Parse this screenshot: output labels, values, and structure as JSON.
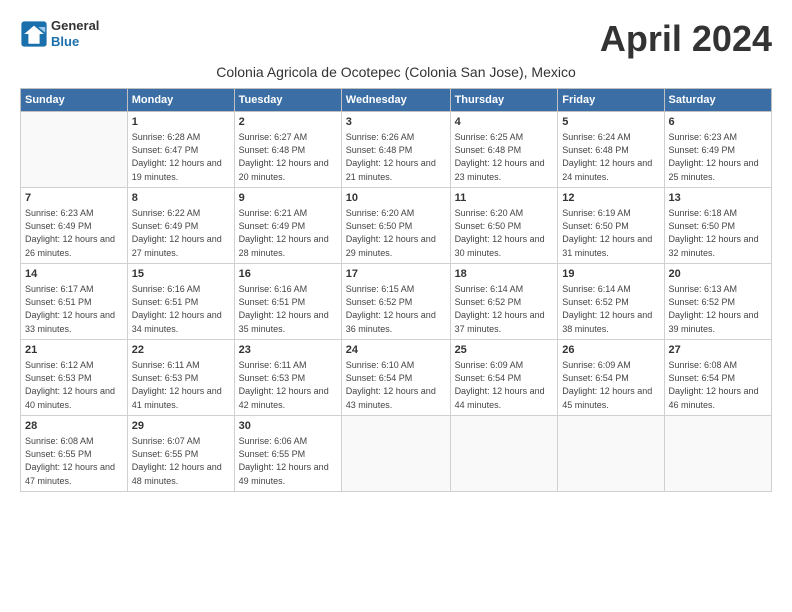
{
  "header": {
    "logo_line1": "General",
    "logo_line2": "Blue",
    "month": "April 2024",
    "subtitle": "Colonia Agricola de Ocotepec (Colonia San Jose), Mexico"
  },
  "weekdays": [
    "Sunday",
    "Monday",
    "Tuesday",
    "Wednesday",
    "Thursday",
    "Friday",
    "Saturday"
  ],
  "weeks": [
    [
      {
        "day": null
      },
      {
        "day": "1",
        "sunrise": "6:28 AM",
        "sunset": "6:47 PM",
        "daylight": "12 hours and 19 minutes."
      },
      {
        "day": "2",
        "sunrise": "6:27 AM",
        "sunset": "6:48 PM",
        "daylight": "12 hours and 20 minutes."
      },
      {
        "day": "3",
        "sunrise": "6:26 AM",
        "sunset": "6:48 PM",
        "daylight": "12 hours and 21 minutes."
      },
      {
        "day": "4",
        "sunrise": "6:25 AM",
        "sunset": "6:48 PM",
        "daylight": "12 hours and 23 minutes."
      },
      {
        "day": "5",
        "sunrise": "6:24 AM",
        "sunset": "6:48 PM",
        "daylight": "12 hours and 24 minutes."
      },
      {
        "day": "6",
        "sunrise": "6:23 AM",
        "sunset": "6:49 PM",
        "daylight": "12 hours and 25 minutes."
      }
    ],
    [
      {
        "day": "7",
        "sunrise": "6:23 AM",
        "sunset": "6:49 PM",
        "daylight": "12 hours and 26 minutes."
      },
      {
        "day": "8",
        "sunrise": "6:22 AM",
        "sunset": "6:49 PM",
        "daylight": "12 hours and 27 minutes."
      },
      {
        "day": "9",
        "sunrise": "6:21 AM",
        "sunset": "6:49 PM",
        "daylight": "12 hours and 28 minutes."
      },
      {
        "day": "10",
        "sunrise": "6:20 AM",
        "sunset": "6:50 PM",
        "daylight": "12 hours and 29 minutes."
      },
      {
        "day": "11",
        "sunrise": "6:20 AM",
        "sunset": "6:50 PM",
        "daylight": "12 hours and 30 minutes."
      },
      {
        "day": "12",
        "sunrise": "6:19 AM",
        "sunset": "6:50 PM",
        "daylight": "12 hours and 31 minutes."
      },
      {
        "day": "13",
        "sunrise": "6:18 AM",
        "sunset": "6:50 PM",
        "daylight": "12 hours and 32 minutes."
      }
    ],
    [
      {
        "day": "14",
        "sunrise": "6:17 AM",
        "sunset": "6:51 PM",
        "daylight": "12 hours and 33 minutes."
      },
      {
        "day": "15",
        "sunrise": "6:16 AM",
        "sunset": "6:51 PM",
        "daylight": "12 hours and 34 minutes."
      },
      {
        "day": "16",
        "sunrise": "6:16 AM",
        "sunset": "6:51 PM",
        "daylight": "12 hours and 35 minutes."
      },
      {
        "day": "17",
        "sunrise": "6:15 AM",
        "sunset": "6:52 PM",
        "daylight": "12 hours and 36 minutes."
      },
      {
        "day": "18",
        "sunrise": "6:14 AM",
        "sunset": "6:52 PM",
        "daylight": "12 hours and 37 minutes."
      },
      {
        "day": "19",
        "sunrise": "6:14 AM",
        "sunset": "6:52 PM",
        "daylight": "12 hours and 38 minutes."
      },
      {
        "day": "20",
        "sunrise": "6:13 AM",
        "sunset": "6:52 PM",
        "daylight": "12 hours and 39 minutes."
      }
    ],
    [
      {
        "day": "21",
        "sunrise": "6:12 AM",
        "sunset": "6:53 PM",
        "daylight": "12 hours and 40 minutes."
      },
      {
        "day": "22",
        "sunrise": "6:11 AM",
        "sunset": "6:53 PM",
        "daylight": "12 hours and 41 minutes."
      },
      {
        "day": "23",
        "sunrise": "6:11 AM",
        "sunset": "6:53 PM",
        "daylight": "12 hours and 42 minutes."
      },
      {
        "day": "24",
        "sunrise": "6:10 AM",
        "sunset": "6:54 PM",
        "daylight": "12 hours and 43 minutes."
      },
      {
        "day": "25",
        "sunrise": "6:09 AM",
        "sunset": "6:54 PM",
        "daylight": "12 hours and 44 minutes."
      },
      {
        "day": "26",
        "sunrise": "6:09 AM",
        "sunset": "6:54 PM",
        "daylight": "12 hours and 45 minutes."
      },
      {
        "day": "27",
        "sunrise": "6:08 AM",
        "sunset": "6:54 PM",
        "daylight": "12 hours and 46 minutes."
      }
    ],
    [
      {
        "day": "28",
        "sunrise": "6:08 AM",
        "sunset": "6:55 PM",
        "daylight": "12 hours and 47 minutes."
      },
      {
        "day": "29",
        "sunrise": "6:07 AM",
        "sunset": "6:55 PM",
        "daylight": "12 hours and 48 minutes."
      },
      {
        "day": "30",
        "sunrise": "6:06 AM",
        "sunset": "6:55 PM",
        "daylight": "12 hours and 49 minutes."
      },
      {
        "day": null
      },
      {
        "day": null
      },
      {
        "day": null
      },
      {
        "day": null
      }
    ]
  ]
}
